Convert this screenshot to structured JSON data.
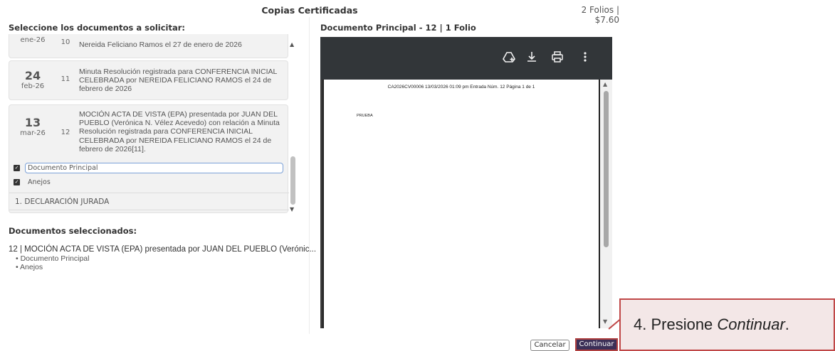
{
  "header": {
    "title": "Copias Certificadas",
    "price": "2 Folios | $7.60"
  },
  "left": {
    "heading": "Seleccione los documentos a solicitar:",
    "documents": [
      {
        "day": "",
        "month": "ene-26",
        "number": "10",
        "text": "Nereida Feliciano Ramos el 27 de enero de 2026"
      },
      {
        "day": "24",
        "month": "feb-26",
        "number": "11",
        "text": "Minuta Resolución registrada para CONFERENCIA INICIAL CELEBRADA por NEREIDA FELICIANO RAMOS el 24 de febrero de 2026"
      },
      {
        "day": "13",
        "month": "mar-26",
        "number": "12",
        "text": "MOCIÓN ACTA DE VISTA (EPA) presentada por JUAN DEL PUEBLO (Verónica N. Vélez Acevedo) con relación a Minuta Resolución registrada para CONFERENCIA INICIAL CELEBRADA por NEREIDA FELICIANO RAMOS el 24 de febrero de 2026[11]."
      }
    ],
    "sub_options": {
      "principal": "Documento Principal",
      "anejos": "Anejos"
    },
    "annex_item": "1. DECLARACIÓN JURADA"
  },
  "selected": {
    "heading": "Documentos seleccionados:",
    "title": "12 | MOCIÓN ACTA DE VISTA (EPA) presentada por JUAN DEL PUEBLO (Verónic...",
    "bullets": [
      "• Documento Principal",
      "• Anejos"
    ]
  },
  "viewer": {
    "heading": "Documento Principal - 12 | 1 Folio",
    "pdf_header": "CA2026CV00006  13/03/2026 01:09 pm Entrada Núm. 12 Página 1 de 1",
    "pdf_body": "PRUEBA",
    "toolbar_icons": [
      "drive-add-icon",
      "download-icon",
      "print-icon",
      "more-icon"
    ]
  },
  "buttons": {
    "cancel": "Cancelar",
    "continue": "Continuar"
  },
  "callout": {
    "prefix": "4. Presione ",
    "emphasis": "Continuar",
    "suffix": "."
  },
  "colors": {
    "continue_bg": "#3b2f57",
    "callout_border": "#c04848",
    "callout_bg": "#f3e7e7",
    "pdf_toolbar": "#323639"
  }
}
